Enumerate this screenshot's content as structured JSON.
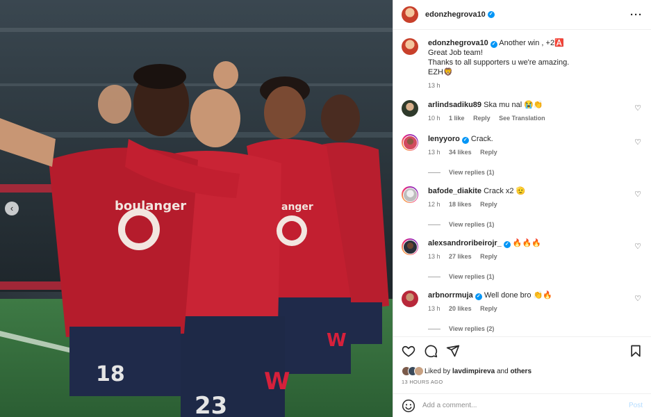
{
  "post": {
    "username": "edonzhegrova10",
    "carousel_prev": "‹"
  },
  "caption": {
    "username": "edonzhegrova10",
    "line1": "Another win , +2🅰️",
    "line2": "Great Job team!",
    "line3": "Thanks to all supporters u we're amazing.",
    "line4": "EZH🦁",
    "time": "13 h"
  },
  "comments": [
    {
      "username": "arlindsadiku89",
      "text": "Ska mu nal 😭👏",
      "time": "10 h",
      "likes": "1 like",
      "reply": "Reply",
      "translate": "See Translation",
      "verified": false
    },
    {
      "username": "lenyyoro",
      "text": "Crack.",
      "time": "13 h",
      "likes": "34 likes",
      "reply": "Reply",
      "view_replies": "View replies (1)",
      "verified": true
    },
    {
      "username": "bafode_diakite",
      "text": "Crack x2 🫡",
      "time": "12 h",
      "likes": "18 likes",
      "reply": "Reply",
      "view_replies": "View replies (1)",
      "verified": false
    },
    {
      "username": "alexsandroribeirojr_",
      "text": "🔥🔥🔥",
      "time": "13 h",
      "likes": "27 likes",
      "reply": "Reply",
      "view_replies": "View replies (1)",
      "verified": true
    },
    {
      "username": "arbnorrmuja",
      "text": "Well done bro 👏🔥",
      "time": "13 h",
      "likes": "20 likes",
      "reply": "Reply",
      "view_replies": "View replies (2)",
      "verified": true
    }
  ],
  "likes": {
    "prefix": "Liked by",
    "user": "lavdimpireva",
    "and": "and",
    "others": "others"
  },
  "timestamp": "13 HOURS AGO",
  "add_comment": {
    "placeholder": "Add a comment...",
    "post_label": "Post"
  },
  "icons": {
    "more": "more-options-icon",
    "heart": "heart-icon",
    "comment": "comment-icon",
    "share": "share-icon",
    "bookmark": "bookmark-icon",
    "emoji": "emoji-icon"
  },
  "colors": {
    "verified": "#0095f6",
    "link_muted": "#737373",
    "post_disabled": "#b3dbff",
    "jersey_red": "#c21f30"
  }
}
